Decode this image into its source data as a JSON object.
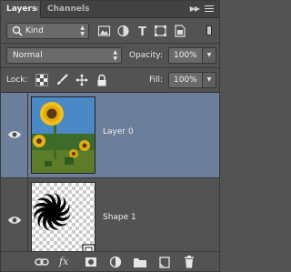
{
  "tabs": [
    {
      "label": "Layers",
      "close_glyph": "x"
    },
    {
      "label": "Channels"
    }
  ],
  "filter": {
    "kind_label": "Kind"
  },
  "blend": {
    "mode": "Normal",
    "opacity_label": "Opacity:",
    "opacity_value": "100%"
  },
  "lock": {
    "label": "Lock:",
    "fill_label": "Fill:",
    "fill_value": "100%"
  },
  "layers": [
    {
      "name": "Layer 0",
      "selected": true,
      "visible": true
    },
    {
      "name": "Shape 1",
      "selected": false,
      "visible": true
    }
  ],
  "colors": {
    "panel": "#535353",
    "selection": "#6b7e9a",
    "field": "#6a6a6a"
  },
  "icons": {
    "filter": [
      "image-filter-icon",
      "adjustment-filter-icon",
      "type-filter-icon",
      "shape-filter-icon",
      "smart-object-filter-icon"
    ],
    "lock": [
      "lock-transparent-pixels-icon",
      "lock-image-pixels-icon",
      "lock-position-icon",
      "lock-all-icon"
    ],
    "bottom": [
      "link-layers-icon",
      "fx-icon",
      "add-mask-icon",
      "new-adjustment-icon",
      "new-group-icon",
      "new-layer-icon",
      "trash-icon"
    ]
  },
  "fx_text": "fx"
}
